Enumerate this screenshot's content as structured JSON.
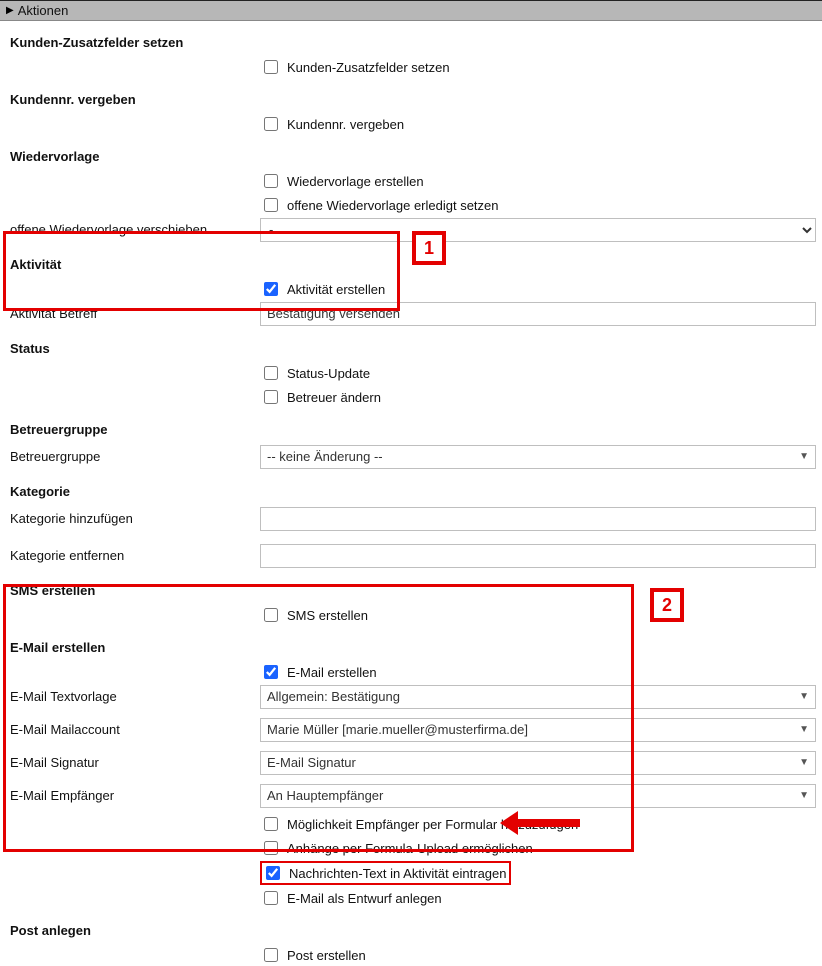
{
  "header": {
    "title": "Aktionen"
  },
  "callouts": {
    "one": "1",
    "two": "2"
  },
  "kunden_zusatz": {
    "heading": "Kunden-Zusatzfelder setzen",
    "cb_label": "Kunden-Zusatzfelder setzen"
  },
  "kundennr": {
    "heading": "Kundennr. vergeben",
    "cb_label": "Kundennr. vergeben"
  },
  "wiedervorlage": {
    "heading": "Wiedervorlage",
    "cb_erstellen": "Wiedervorlage erstellen",
    "cb_erledigt": "offene Wiedervorlage erledigt setzen",
    "shift_label": "offene Wiedervorlage verschieben",
    "shift_value": "-"
  },
  "aktivitaet": {
    "heading": "Aktivität",
    "cb_erstellen": "Aktivität erstellen",
    "betreff_label": "Aktivität Betreff",
    "betreff_value": "Bestätigung versenden"
  },
  "status": {
    "heading": "Status",
    "cb_update": "Status-Update",
    "cb_betreuer": "Betreuer ändern"
  },
  "betreuer": {
    "heading": "Betreuergruppe",
    "label": "Betreuergruppe",
    "value": "-- keine Änderung --"
  },
  "kategorie": {
    "heading": "Kategorie",
    "add_label": "Kategorie hinzufügen",
    "remove_label": "Kategorie entfernen"
  },
  "sms": {
    "heading": "SMS erstellen",
    "cb_label": "SMS erstellen"
  },
  "email": {
    "heading": "E-Mail erstellen",
    "cb_erstellen": "E-Mail erstellen",
    "vorlage_label": "E-Mail Textvorlage",
    "vorlage_value": "Allgemein: Bestätigung",
    "account_label": "E-Mail Mailaccount",
    "account_value": "Marie Müller [marie.mueller@musterfirma.de]",
    "signatur_label": "E-Mail Signatur",
    "signatur_value": "E-Mail Signatur",
    "empf_label": "E-Mail Empfänger",
    "empf_value": "An Hauptempfänger",
    "cb_formular": "Möglichkeit Empfänger per Formular hinzuzufügen",
    "cb_anhaenge": "Anhänge per Formula-Upload ermöglichen",
    "cb_nachricht": "Nachrichten-Text in Aktivität eintragen",
    "cb_entwurf": "E-Mail als Entwurf anlegen"
  },
  "post": {
    "heading": "Post anlegen",
    "cb_label": "Post erstellen"
  }
}
